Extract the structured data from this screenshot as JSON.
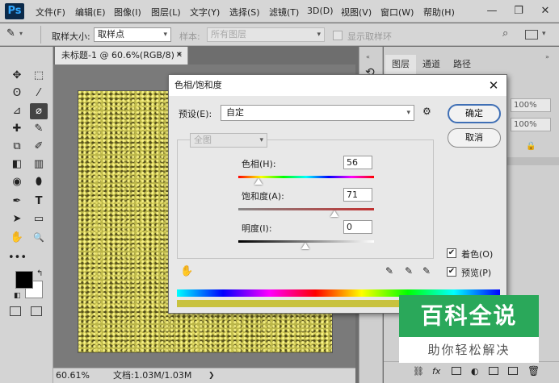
{
  "app": {
    "logo": "Ps"
  },
  "menu": [
    "文件(F)",
    "编辑(E)",
    "图像(I)",
    "图层(L)",
    "文字(Y)",
    "选择(S)",
    "滤镜(T)",
    "3D(D)",
    "视图(V)",
    "窗口(W)",
    "帮助(H)"
  ],
  "window_controls": {
    "minimize": "—",
    "restore": "❐",
    "close": "✕"
  },
  "options_bar": {
    "sample_size_label": "取样大小:",
    "sample_size_value": "取样点",
    "sample_label": "样本:",
    "sample_value": "所有图层",
    "show_ring_label": "显示取样环"
  },
  "tools": [
    "✥",
    "⬚",
    "ʘ",
    "⁄",
    "⊿",
    "⌀",
    "✚",
    "✎",
    "⧉",
    "✐",
    "◧",
    "▥",
    "◉",
    "⬮",
    "✒",
    "T",
    "➤",
    "▭",
    "✋",
    "🔍",
    "•••"
  ],
  "document": {
    "tab_title": "未标题-1 @ 60.6%(RGB/8) *",
    "tab_close": "✕",
    "zoom": "60.61%",
    "doc_info": "文档:1.03M/1.03M"
  },
  "panels": {
    "tabs": [
      "图层",
      "通道",
      "路径"
    ],
    "opacity_value": "100%",
    "fill_value": "100%"
  },
  "dialog": {
    "title": "色相/饱和度",
    "preset_label": "预设(E):",
    "preset_value": "自定",
    "channel_value": "全图",
    "ok_label": "确定",
    "cancel_label": "取消",
    "hue_label": "色相(H):",
    "hue_value": "56",
    "saturation_label": "饱和度(A):",
    "saturation_value": "71",
    "lightness_label": "明度(I):",
    "lightness_value": "0",
    "colorize_label": "着色(O)",
    "colorize_checked": true,
    "preview_label": "预览(P)",
    "preview_checked": true
  },
  "watermark": {
    "title": "百科全说",
    "subtitle": "助你轻松解决"
  },
  "colors": {
    "accent": "#3f6fb5",
    "watermark_green": "#2aa85a",
    "artwork_base": "#bdb84a"
  }
}
